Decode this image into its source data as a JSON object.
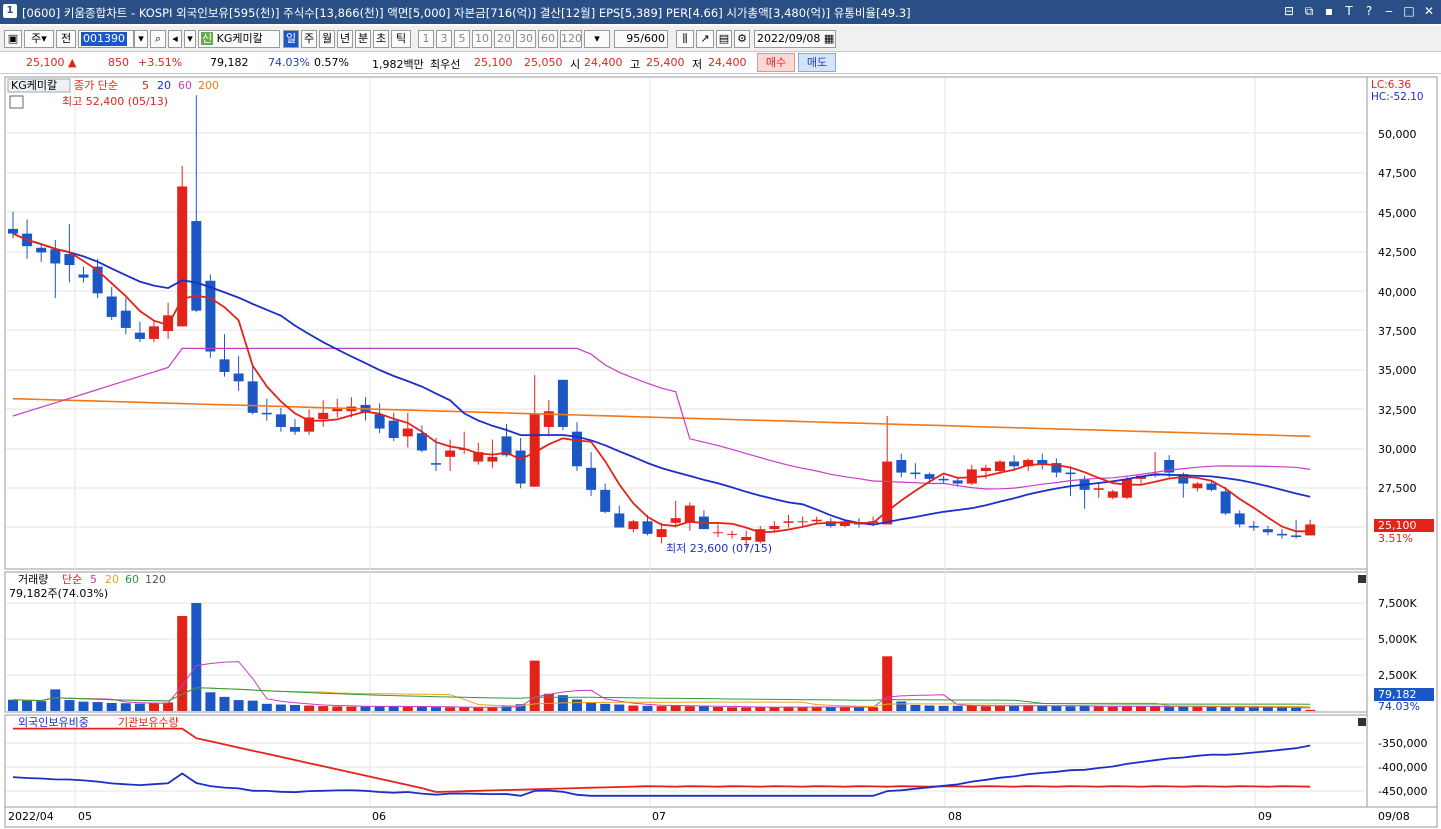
{
  "titlebar": {
    "window_num": "1",
    "text": "[0600] 키움종합차트 - KOSPI 외국인보유[595(천)] 주식수[13,866(천)] 액면[5,000] 자본금[716(억)] 결산[12월] EPS[5,389] PER[4.66] 시가총액[3,480(억)] 유통비율[49.3]",
    "buttons": [
      "⊟",
      "⧉",
      "▪",
      "T",
      "?",
      "‒",
      "□",
      "✕"
    ]
  },
  "toolbar": {
    "period": "주",
    "all": "전",
    "code": "001390",
    "stock_badge": "신",
    "stock_name": "KG케미칼",
    "tabs": [
      "일",
      "주",
      "월",
      "년",
      "분",
      "초",
      "틱"
    ],
    "intervals": [
      "1",
      "3",
      "5",
      "10",
      "20",
      "30",
      "60",
      "120"
    ],
    "count": "95",
    "count_total": "/600",
    "date": "2022/09/08"
  },
  "quote": {
    "price": "25,100",
    "arrow": "▲",
    "change": "850",
    "change_pct": "+3.51%",
    "volume": "79,182",
    "vol_ratio": "74.03%",
    "turnover": "0.57%",
    "amount": "1,982백만",
    "best_ask_label": "최우선",
    "best_ask": "25,100",
    "best_bid": "25,050",
    "open_label": "시",
    "open": "24,400",
    "high_label": "고",
    "high": "25,400",
    "low_label": "저",
    "low": "24,400",
    "buy": "매수",
    "sell": "매도"
  },
  "colors": {
    "up": "#e2231a",
    "down": "#1b57c5",
    "ma5": "#e2231a",
    "ma20": "#1b2fc8",
    "ma60": "#c83cc8",
    "ma200": "#f07818"
  },
  "price_panel": {
    "name": "KG케미칼",
    "legend_prefix": "종가 단순",
    "ma_labels": [
      "5",
      "20",
      "60",
      "200"
    ],
    "high_label": "최고 52,400 (05/13)",
    "low_label": "최저 23,600 (07/15)",
    "lc": "LC:6.36",
    "hc": "HC:-52.10",
    "price_tag": "25,100",
    "pct_tag": "3.51%",
    "y_ticks": [
      "50,000",
      "47,500",
      "45,000",
      "42,500",
      "40,000",
      "37,500",
      "35,000",
      "32,500",
      "30,000",
      "27,500"
    ]
  },
  "volume_panel": {
    "title": "거래량",
    "legend_prefix": "단순",
    "ma_labels": [
      "5",
      "20",
      "60",
      "120"
    ],
    "info": "79,182주(74.03%)",
    "y_ticks": [
      "7,500K",
      "5,000K",
      "2,500K"
    ],
    "tag": "79,182",
    "tag_pct": "74.03%"
  },
  "foreign_panel": {
    "title1": "외국인보유비중",
    "title2": "기관보유수량",
    "y_ticks": [
      "-350,000",
      "-400,000",
      "-450,000"
    ]
  },
  "x_axis": {
    "labels": [
      "2022/04",
      "05",
      "06",
      "07",
      "08",
      "09"
    ],
    "end": "09/08"
  },
  "chart_data": {
    "type": "candlestick",
    "y_range": [
      22500,
      53000
    ],
    "candles": [
      [
        43900,
        45000,
        43300,
        43600
      ],
      [
        43600,
        44500,
        42000,
        42800
      ],
      [
        42700,
        43000,
        41800,
        42400
      ],
      [
        42600,
        43200,
        39500,
        41700
      ],
      [
        42300,
        44200,
        40500,
        41600
      ],
      [
        41000,
        41500,
        40500,
        40800
      ],
      [
        41500,
        42000,
        39500,
        39800
      ],
      [
        39600,
        40200,
        38100,
        38300
      ],
      [
        38700,
        39500,
        37200,
        37600
      ],
      [
        37300,
        38000,
        36700,
        36900
      ],
      [
        36900,
        38100,
        36700,
        37700
      ],
      [
        37400,
        39200,
        36900,
        38400
      ],
      [
        37700,
        47900,
        37700,
        46600
      ],
      [
        44400,
        52400,
        38600,
        38700
      ],
      [
        40600,
        41000,
        35700,
        36100
      ],
      [
        35600,
        37200,
        34500,
        34800
      ],
      [
        34700,
        35800,
        33600,
        34200
      ],
      [
        34200,
        35200,
        32100,
        32200
      ],
      [
        32200,
        33100,
        31700,
        32100
      ],
      [
        32100,
        32500,
        31000,
        31300
      ],
      [
        31300,
        31800,
        30800,
        31000
      ],
      [
        31000,
        32400,
        30800,
        31900
      ],
      [
        31800,
        33000,
        31300,
        32200
      ],
      [
        32300,
        33100,
        31900,
        32500
      ],
      [
        32300,
        33200,
        31900,
        32600
      ],
      [
        32700,
        33200,
        31700,
        32200
      ],
      [
        32100,
        32800,
        30900,
        31200
      ],
      [
        31700,
        32200,
        30400,
        30600
      ],
      [
        30700,
        32200,
        30000,
        31200
      ],
      [
        30900,
        31400,
        29700,
        29800
      ],
      [
        29000,
        30600,
        28500,
        28900
      ],
      [
        29400,
        30500,
        28500,
        29800
      ],
      [
        29900,
        31000,
        29600,
        29900
      ],
      [
        29100,
        30300,
        28900,
        29700
      ],
      [
        29100,
        30500,
        28700,
        29400
      ],
      [
        30700,
        31500,
        29400,
        29500
      ],
      [
        29800,
        30600,
        27400,
        27700
      ],
      [
        27500,
        34600,
        27500,
        32100
      ],
      [
        31300,
        33000,
        30700,
        32300
      ],
      [
        34300,
        34300,
        31100,
        31300
      ],
      [
        31000,
        31600,
        28500,
        28800
      ],
      [
        28700,
        29700,
        26900,
        27300
      ],
      [
        27300,
        27700,
        25800,
        25900
      ],
      [
        25800,
        26300,
        24900,
        24900
      ],
      [
        24800,
        25400,
        24600,
        25300
      ],
      [
        25300,
        25700,
        24400,
        24500
      ],
      [
        24300,
        25200,
        23900,
        24800
      ],
      [
        25200,
        26600,
        24900,
        25500
      ],
      [
        25200,
        26500,
        24700,
        26300
      ],
      [
        25600,
        26000,
        24800,
        24800
      ],
      [
        24600,
        25100,
        24300,
        24600
      ],
      [
        24500,
        24700,
        24200,
        24500
      ],
      [
        24100,
        24700,
        23600,
        24300
      ],
      [
        24000,
        25000,
        23900,
        24800
      ],
      [
        24800,
        25300,
        24600,
        25000
      ],
      [
        25200,
        25700,
        24900,
        25300
      ],
      [
        25300,
        25600,
        24900,
        25300
      ],
      [
        25300,
        25600,
        25100,
        25400
      ],
      [
        25300,
        25500,
        24900,
        25000
      ],
      [
        25000,
        25400,
        24900,
        25200
      ],
      [
        25200,
        25500,
        24900,
        25100
      ],
      [
        25200,
        25600,
        25000,
        25300
      ],
      [
        25100,
        32000,
        25100,
        29100
      ],
      [
        29200,
        29600,
        28100,
        28400
      ],
      [
        28400,
        29000,
        28000,
        28300
      ],
      [
        28300,
        28400,
        27700,
        28000
      ],
      [
        28000,
        28200,
        27700,
        27900
      ],
      [
        27900,
        28100,
        27500,
        27700
      ],
      [
        27700,
        28900,
        27600,
        28600
      ],
      [
        28500,
        28900,
        28000,
        28700
      ],
      [
        28500,
        29200,
        28300,
        29100
      ],
      [
        29100,
        29500,
        28600,
        28800
      ],
      [
        28800,
        29300,
        28500,
        29200
      ],
      [
        29200,
        29600,
        28600,
        28900
      ],
      [
        29000,
        29300,
        28100,
        28400
      ],
      [
        28400,
        28800,
        26900,
        28300
      ],
      [
        28000,
        28200,
        26100,
        27300
      ],
      [
        27300,
        27800,
        26800,
        27400
      ],
      [
        26800,
        27300,
        26700,
        27200
      ],
      [
        26800,
        28200,
        26700,
        28000
      ],
      [
        28000,
        28200,
        27700,
        28200
      ],
      [
        28200,
        29700,
        28100,
        28300
      ],
      [
        29200,
        29500,
        28100,
        28400
      ],
      [
        28300,
        28400,
        26800,
        27700
      ],
      [
        27400,
        27800,
        27200,
        27700
      ],
      [
        27700,
        27900,
        27200,
        27300
      ],
      [
        27200,
        27500,
        25700,
        25800
      ],
      [
        25800,
        26000,
        24900,
        25100
      ],
      [
        25000,
        25300,
        24700,
        24900
      ],
      [
        24800,
        25000,
        24400,
        24600
      ],
      [
        24500,
        24800,
        24200,
        24400
      ],
      [
        24400,
        25400,
        24200,
        24300
      ],
      [
        24400,
        25400,
        24400,
        25100
      ]
    ],
    "volume": [
      780,
      720,
      690,
      1500,
      760,
      650,
      620,
      560,
      540,
      510,
      520,
      590,
      6600,
      7500,
      1300,
      980,
      760,
      720,
      500,
      450,
      420,
      380,
      340,
      320,
      300,
      310,
      330,
      350,
      290,
      280,
      270,
      260,
      250,
      240,
      280,
      330,
      470,
      3500,
      1200,
      1100,
      800,
      600,
      500,
      450,
      380,
      360,
      340,
      380,
      330,
      330,
      280,
      260,
      250,
      260,
      280,
      300,
      270,
      280,
      260,
      270,
      260,
      270,
      3800,
      660,
      420,
      380,
      360,
      360,
      380,
      330,
      380,
      360,
      400,
      350,
      360,
      330,
      350,
      310,
      300,
      360,
      310,
      340,
      300,
      320,
      300,
      300,
      280,
      280,
      250,
      260,
      240,
      220,
      79
    ]
  }
}
